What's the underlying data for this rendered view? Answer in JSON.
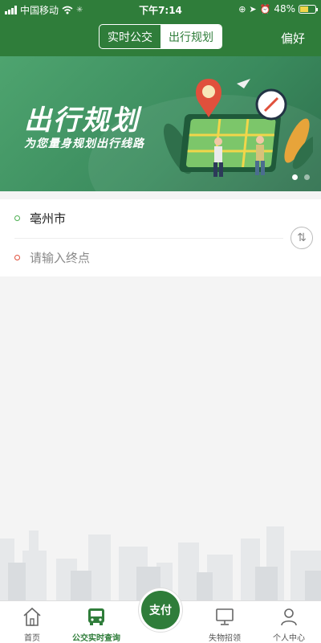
{
  "status": {
    "carrier": "中国移动",
    "time": "下午7:14",
    "battery": "48%",
    "battery_level": 0.48
  },
  "header": {
    "tabs": [
      {
        "label": "实时公交",
        "active": false
      },
      {
        "label": "出行规划",
        "active": true
      }
    ],
    "prefs": "偏好"
  },
  "banner": {
    "title": "出行规划",
    "subtitle": "为您量身规划出行线路",
    "dots": 2,
    "active_dot": 0
  },
  "route": {
    "start": "亳州市",
    "end_placeholder": "请输入终点",
    "start_color": "#4caf50",
    "end_color": "#e0503c"
  },
  "tabbar": {
    "items": [
      {
        "label": "首页",
        "icon": "home-icon"
      },
      {
        "label": "公交实时查询",
        "icon": "bus-icon",
        "active": true
      },
      {
        "label": "失物招领",
        "icon": "monitor-icon"
      },
      {
        "label": "个人中心",
        "icon": "person-icon"
      }
    ],
    "pay": "支付"
  },
  "colors": {
    "brand": "#2f7d3a"
  }
}
